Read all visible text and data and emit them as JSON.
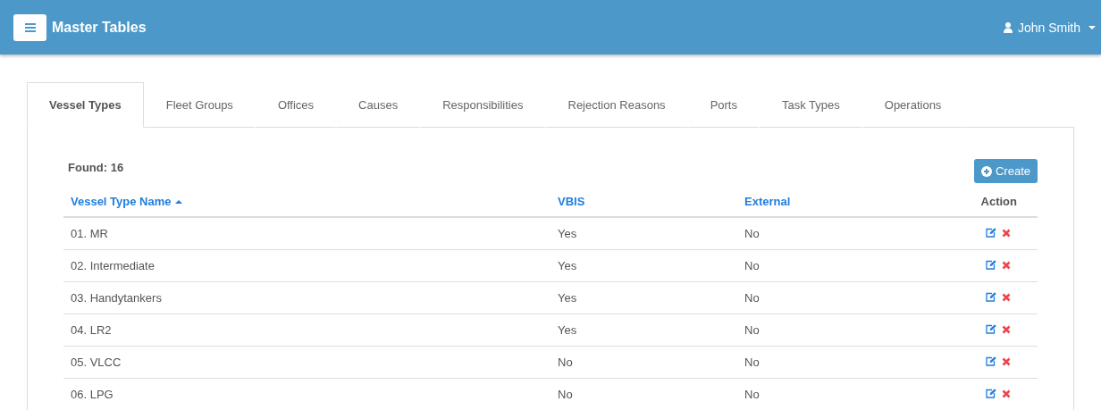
{
  "header": {
    "title": "Master Tables",
    "user": "John Smith"
  },
  "tabs": [
    {
      "label": "Vessel Types",
      "selected": true
    },
    {
      "label": "Fleet Groups",
      "selected": false
    },
    {
      "label": "Offices",
      "selected": false
    },
    {
      "label": "Causes",
      "selected": false
    },
    {
      "label": "Responsibilities",
      "selected": false
    },
    {
      "label": "Rejection Reasons",
      "selected": false
    },
    {
      "label": "Ports",
      "selected": false
    },
    {
      "label": "Task Types",
      "selected": false
    },
    {
      "label": "Operations",
      "selected": false
    }
  ],
  "found": "Found: 16",
  "create_button": "Create",
  "table": {
    "columns": [
      {
        "label": "Vessel Type Name",
        "sorted_ascending": true
      },
      {
        "label": "VBIS",
        "sorted_ascending": false
      },
      {
        "label": "External",
        "sorted_ascending": false
      },
      {
        "label": "Action",
        "sorted_ascending": false
      }
    ],
    "rows": [
      {
        "name": "01. MR",
        "vbis": "Yes",
        "external": "No"
      },
      {
        "name": "02. Intermediate",
        "vbis": "Yes",
        "external": "No"
      },
      {
        "name": "03. Handytankers",
        "vbis": "Yes",
        "external": "No"
      },
      {
        "name": "04. LR2",
        "vbis": "Yes",
        "external": "No"
      },
      {
        "name": "05. VLCC",
        "vbis": "No",
        "external": "No"
      },
      {
        "name": "06. LPG",
        "vbis": "No",
        "external": "No"
      }
    ]
  }
}
